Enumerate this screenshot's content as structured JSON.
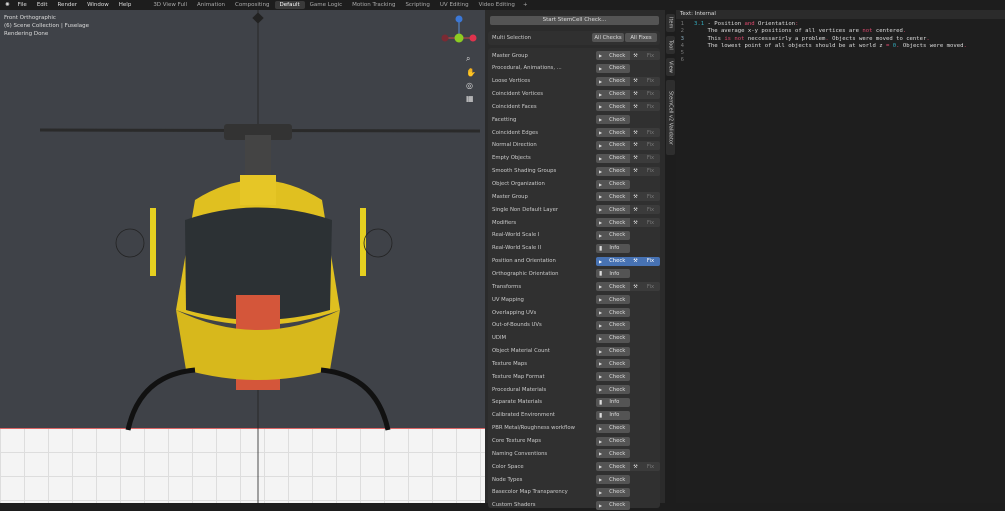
{
  "menu": {
    "items": [
      "File",
      "Edit",
      "Render",
      "Window",
      "Help"
    ]
  },
  "workspaces": [
    {
      "label": "3D View Full"
    },
    {
      "label": "Animation"
    },
    {
      "label": "Compositing"
    },
    {
      "label": "Default",
      "active": true
    },
    {
      "label": "Game Logic"
    },
    {
      "label": "Motion Tracking"
    },
    {
      "label": "Scripting"
    },
    {
      "label": "UV Editing"
    },
    {
      "label": "Video Editing"
    }
  ],
  "add_workspace": "+",
  "viewport": {
    "view_name": "Front Orthographic",
    "collection": "(6) Scene Collection | Fuselage",
    "status": "Rendering Done",
    "gizmo_axes": [
      "Z",
      "Y",
      "X"
    ]
  },
  "panel": {
    "start_button": "Start StemCell Check...",
    "multi_selection": {
      "label": "Multi Selection",
      "all_checks": "All Checks",
      "all_fixes": "All Fixes"
    },
    "check_label": "Check",
    "info_label": "Info",
    "fix_label": "Fix",
    "rows": [
      {
        "label": "Master Group",
        "type": "check",
        "fix": true
      },
      {
        "label": "Procedural, Animations, ...",
        "type": "check",
        "fix": false
      },
      {
        "label": "Loose Vertices",
        "type": "check",
        "fix": true
      },
      {
        "label": "Coincident Vertices",
        "type": "check",
        "fix": true
      },
      {
        "label": "Coincident Faces",
        "type": "check",
        "fix": true
      },
      {
        "label": "Facetting",
        "type": "check",
        "fix": false
      },
      {
        "label": "Coincident Edges",
        "type": "check",
        "fix": true
      },
      {
        "label": "Normal Direction",
        "type": "check",
        "fix": true
      },
      {
        "label": "Empty Objects",
        "type": "check",
        "fix": true
      },
      {
        "label": "Smooth Shading Groups",
        "type": "check",
        "fix": true
      },
      {
        "label": "Object Organization",
        "type": "check",
        "fix": false
      },
      {
        "label": "Master Group",
        "type": "check",
        "fix": true
      },
      {
        "label": "Single Non Default Layer",
        "type": "check",
        "fix": true
      },
      {
        "label": "Modifiers",
        "type": "check",
        "fix": true
      },
      {
        "label": "Real-World Scale I",
        "type": "check",
        "fix": false
      },
      {
        "label": "Real-World Scale II",
        "type": "info",
        "fix": false
      },
      {
        "label": "Position and Orientation",
        "type": "check",
        "fix": true,
        "active": true
      },
      {
        "label": "Orthographic Orientation",
        "type": "info",
        "fix": false
      },
      {
        "label": "Transforms",
        "type": "check",
        "fix": true
      },
      {
        "label": "UV Mapping",
        "type": "check",
        "fix": false
      },
      {
        "label": "Overlapping UVs",
        "type": "check",
        "fix": false
      },
      {
        "label": "Out-of-Bounds UVs",
        "type": "check",
        "fix": false
      },
      {
        "label": "UDIM",
        "type": "check",
        "fix": false
      },
      {
        "label": "Object Material Count",
        "type": "check",
        "fix": false
      },
      {
        "label": "Texture Maps",
        "type": "check",
        "fix": false
      },
      {
        "label": "Texture Map Format",
        "type": "check",
        "fix": false
      },
      {
        "label": "Procedural Materials",
        "type": "check",
        "fix": false
      },
      {
        "label": "Separate Materials",
        "type": "info",
        "fix": false
      },
      {
        "label": "Calibrated Environment",
        "type": "info",
        "fix": false
      },
      {
        "label": "PBR Metal/Roughness workflow",
        "type": "check",
        "fix": false
      },
      {
        "label": "Core Texture Maps",
        "type": "check",
        "fix": false
      },
      {
        "label": "Naming Conventions",
        "type": "check",
        "fix": false
      },
      {
        "label": "Color Space",
        "type": "check",
        "fix": true
      },
      {
        "label": "Node Types",
        "type": "check",
        "fix": false
      },
      {
        "label": "Basecolor Map Transparency",
        "type": "check",
        "fix": false
      },
      {
        "label": "Custom Shaders",
        "type": "check",
        "fix": false
      }
    ]
  },
  "side_tabs": [
    "Item",
    "Tool",
    "View",
    "StemCell v2 Validator"
  ],
  "editor": {
    "title": "Text: Internal",
    "current_line": 3,
    "lines": [
      [
        {
          "t": "3.1",
          "c": "num"
        },
        {
          "t": " - Position ",
          "c": "t"
        },
        {
          "t": "and",
          "c": "kw"
        },
        {
          "t": " Orientation",
          "c": "t"
        },
        {
          "t": ":",
          "c": "kw"
        }
      ],
      [
        {
          "t": "    The average x-y positions of all vertices are ",
          "c": "t"
        },
        {
          "t": "not",
          "c": "kw"
        },
        {
          "t": " centered",
          "c": "t"
        },
        {
          "t": ".",
          "c": "kw"
        }
      ],
      [
        {
          "t": "    This ",
          "c": "t"
        },
        {
          "t": "is not",
          "c": "kw"
        },
        {
          "t": " neccessarirly a problem",
          "c": "t"
        },
        {
          "t": ".",
          "c": "kw"
        },
        {
          "t": " Objects were moved to center",
          "c": "t"
        },
        {
          "t": ".",
          "c": "kw"
        }
      ],
      [
        {
          "t": "    The lowest point of all objects should be at world z ",
          "c": "t"
        },
        {
          "t": "=",
          "c": "kw"
        },
        {
          "t": " ",
          "c": "t"
        },
        {
          "t": "0",
          "c": "num"
        },
        {
          "t": ".",
          "c": "kw"
        },
        {
          "t": " Objects were moved",
          "c": "t"
        },
        {
          "t": ".",
          "c": "kw"
        }
      ],
      [],
      []
    ]
  },
  "colors": {
    "accent": "#4772b3",
    "keyword": "#e04a6f",
    "number": "#33aabb",
    "body": "#e8c01a"
  }
}
